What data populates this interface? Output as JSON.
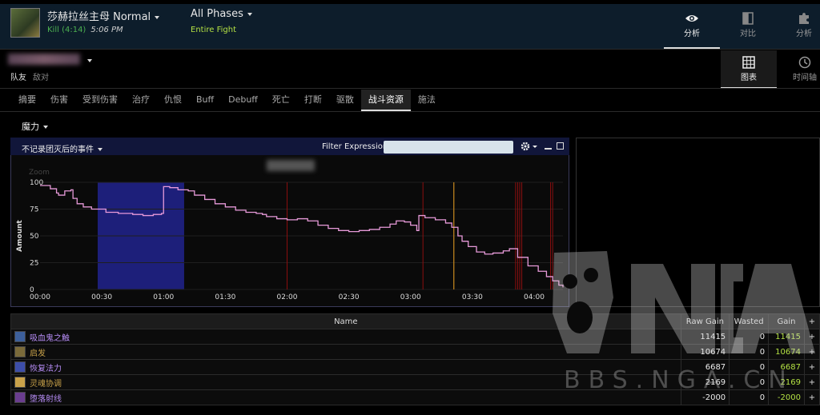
{
  "header": {
    "boss": "莎赫拉丝主母 Normal",
    "kill_text": "Kill (4:14)",
    "kill_time": "5:06 PM",
    "phase": "All Phases",
    "phase_sub": "Entire Fight",
    "nav": [
      {
        "label": "分析",
        "icon": "eye-icon"
      },
      {
        "label": "对比",
        "icon": "compare-icon"
      },
      {
        "label": "分析",
        "icon": "puzzle-icon"
      }
    ]
  },
  "subheader": {
    "tab_team": "队友",
    "tab_enemy": "敌对",
    "nav": [
      {
        "label": "图表",
        "icon": "grid-icon"
      },
      {
        "label": "时间轴",
        "icon": "clock-icon"
      }
    ]
  },
  "tabs": [
    "摘要",
    "伤害",
    "受到伤害",
    "治疗",
    "仇恨",
    "Buff",
    "Debuff",
    "死亡",
    "打断",
    "驱散",
    "战斗资源",
    "施法"
  ],
  "active_tab": "战斗资源",
  "resource": "魔力",
  "chart_panel": {
    "wipe_filter": "不记录团灭后的事件",
    "filter_label": "Filter Expression:",
    "filter_value": "",
    "zoom_label": "Zoom"
  },
  "chart_data": {
    "type": "line",
    "ylabel": "Amount",
    "ylim": [
      0,
      100
    ],
    "y_ticks": [
      "0",
      "25",
      "50",
      "75",
      "100"
    ],
    "xlim_seconds": [
      0,
      254
    ],
    "x_ticks": [
      "00:00",
      "00:30",
      "01:00",
      "01:30",
      "02:00",
      "02:30",
      "03:00",
      "03:30",
      "04:00"
    ],
    "series": [
      {
        "points": [
          [
            0,
            97
          ],
          [
            5,
            94
          ],
          [
            8,
            90
          ],
          [
            9,
            88
          ],
          [
            12,
            92
          ],
          [
            15,
            93
          ],
          [
            16,
            85
          ],
          [
            18,
            80
          ],
          [
            21,
            77
          ],
          [
            25,
            75
          ],
          [
            32,
            72
          ],
          [
            38,
            71
          ],
          [
            45,
            70
          ],
          [
            50,
            69
          ],
          [
            55,
            70
          ],
          [
            59,
            71
          ],
          [
            60,
            96
          ],
          [
            63,
            95
          ],
          [
            67,
            93
          ],
          [
            72,
            92
          ],
          [
            75,
            88
          ],
          [
            80,
            84
          ],
          [
            85,
            80
          ],
          [
            90,
            77
          ],
          [
            95,
            74
          ],
          [
            100,
            72
          ],
          [
            105,
            71
          ],
          [
            108,
            70
          ],
          [
            110,
            68
          ],
          [
            115,
            66
          ],
          [
            120,
            65
          ],
          [
            125,
            66
          ],
          [
            130,
            64
          ],
          [
            135,
            60
          ],
          [
            140,
            57
          ],
          [
            145,
            55
          ],
          [
            150,
            54
          ],
          [
            155,
            55
          ],
          [
            160,
            56
          ],
          [
            165,
            58
          ],
          [
            170,
            61
          ],
          [
            173,
            64
          ],
          [
            177,
            63
          ],
          [
            180,
            60
          ],
          [
            183,
            55
          ],
          [
            184,
            69
          ],
          [
            187,
            67
          ],
          [
            192,
            65
          ],
          [
            197,
            62
          ],
          [
            200,
            58
          ],
          [
            203,
            50
          ],
          [
            205,
            45
          ],
          [
            208,
            40
          ],
          [
            212,
            35
          ],
          [
            216,
            33
          ],
          [
            220,
            34
          ],
          [
            225,
            36
          ],
          [
            228,
            38
          ],
          [
            232,
            30
          ],
          [
            237,
            22
          ],
          [
            242,
            17
          ],
          [
            246,
            12
          ],
          [
            249,
            8
          ],
          [
            252,
            4
          ],
          [
            254,
            2
          ]
        ]
      }
    ],
    "highlight_band_seconds": [
      28,
      70
    ],
    "death_markers_seconds": [
      120,
      186,
      231,
      232,
      233,
      234,
      248,
      249
    ],
    "orange_marker_seconds": 201,
    "colors": {
      "line": "#e79ad9",
      "band": "#1d1f7a",
      "marker": "#8b0f0f",
      "orange": "#c98a1f"
    }
  },
  "table": {
    "columns": [
      "Name",
      "Raw Gain",
      "Wasted",
      "Gain",
      "+"
    ],
    "rows": [
      {
        "name": "吸血鬼之触",
        "raw": "11415",
        "wasted": "0",
        "gain": "11415",
        "plus": "+",
        "icon": "vampiric-touch-icon",
        "color": "#b68cf5"
      },
      {
        "name": "启发",
        "raw": "10674",
        "wasted": "0",
        "gain": "10674",
        "plus": "+",
        "icon": "inspiration-icon",
        "color": "#c9a24a"
      },
      {
        "name": "恢复法力",
        "raw": "6687",
        "wasted": "0",
        "gain": "6687",
        "plus": "+",
        "icon": "mana-potion-icon",
        "color": "#b68cf5"
      },
      {
        "name": "灵魂协调",
        "raw": "2169",
        "wasted": "0",
        "gain": "2169",
        "plus": "+",
        "icon": "spirit-bond-icon",
        "color": "#c9a24a"
      },
      {
        "name": "堕落射线",
        "raw": "-2000",
        "wasted": "0",
        "gain": "-2000",
        "plus": "+",
        "icon": "fallen-ray-icon",
        "color": "#b68cf5"
      }
    ]
  },
  "watermark": "BBS.NGA.CN"
}
